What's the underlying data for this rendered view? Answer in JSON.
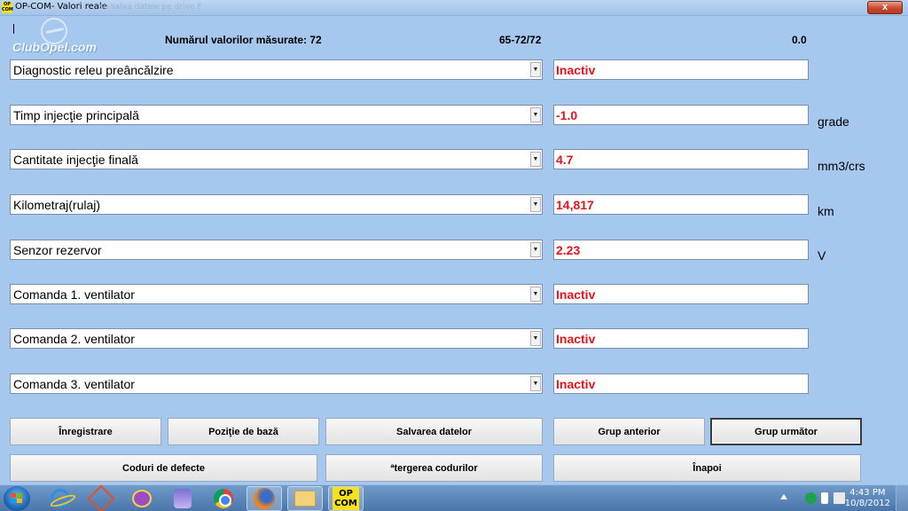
{
  "window": {
    "title": "OP-COM- Valori reale",
    "ghost_title": "se salva datele pe drive F",
    "close": "x",
    "app_icon_text": "OP COM"
  },
  "header": {
    "logo_text": "ClubOpel.com",
    "measured_label": "Numărul valorilor măsurate: 72",
    "range": "65-72/72",
    "time": "0.0"
  },
  "rows": [
    {
      "label": "Diagnostic releu preâncălzire",
      "value": "Inactiv",
      "unit": ""
    },
    {
      "label": "Timp injecţie principală",
      "value": "-1.0",
      "unit": "grade"
    },
    {
      "label": "Cantitate injecţie finală",
      "value": "4.7",
      "unit": "mm3/crs"
    },
    {
      "label": "Kilometraj(rulaj)",
      "value": "14,817",
      "unit": "km"
    },
    {
      "label": "Senzor rezervor",
      "value": "2.23",
      "unit": "V"
    },
    {
      "label": "Comanda  1. ventilator",
      "value": "Inactiv",
      "unit": ""
    },
    {
      "label": "Comanda 2. ventilator",
      "value": "Inactiv",
      "unit": ""
    },
    {
      "label": "Comanda 3. ventilator",
      "value": "Inactiv",
      "unit": ""
    }
  ],
  "buttons": {
    "record": "Înregistrare",
    "base_position": "Poziţie de bază",
    "save_data": "Salvarea datelor",
    "prev_group": "Grup anterior",
    "next_group": "Grup următor",
    "fault_codes": "Coduri de defecte",
    "clear_codes": "ªtergerea codurilor",
    "back": "Înapoi"
  },
  "taskbar": {
    "opcom_label": "OP COM",
    "clock_time": "4:43 PM",
    "clock_date": "10/8/2012"
  },
  "colors": {
    "background": "#a6c8ee",
    "value_text": "#e8131d"
  }
}
